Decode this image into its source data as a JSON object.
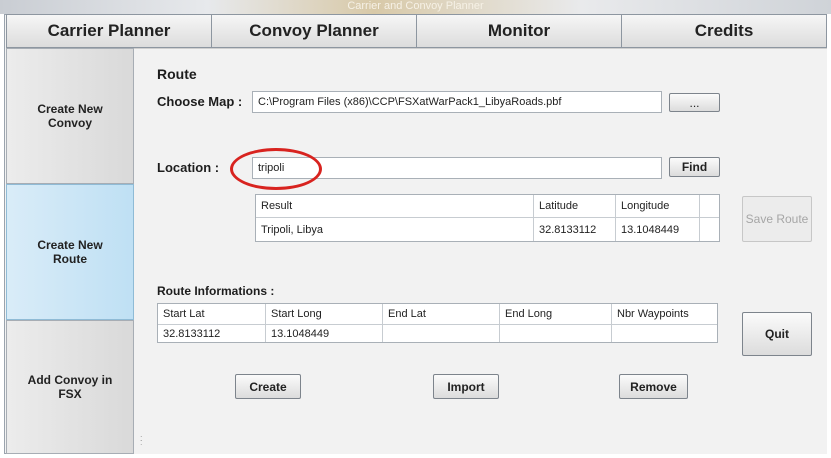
{
  "window": {
    "title": "Carrier and Convoy Planner"
  },
  "tabs": [
    "Carrier Planner",
    "Convoy Planner",
    "Monitor",
    "Credits"
  ],
  "sidebar": {
    "create_convoy": "Create New Convoy",
    "create_route": "Create New Route",
    "add_convoy": "Add Convoy in FSX"
  },
  "route": {
    "section_title": "Route",
    "choose_map_label": "Choose Map :",
    "map_path": "C:\\Program Files (x86)\\CCP\\FSXatWarPack1_LibyaRoads.pbf",
    "browse_label": "...",
    "location_label": "Location :",
    "location_value": "tripoli",
    "find_label": "Find"
  },
  "results": {
    "headers": [
      "Result",
      "Latitude",
      "Longitude"
    ],
    "rows": [
      [
        "Tripoli, Libya",
        "32.8133112",
        "13.1048449"
      ]
    ]
  },
  "route_info": {
    "title": "Route Informations :",
    "headers": [
      "Start Lat",
      "Start Long",
      "End Lat",
      "End Long",
      "Nbr Waypoints"
    ],
    "rows": [
      [
        "32.8133112",
        "13.1048449",
        "",
        "",
        ""
      ]
    ]
  },
  "actions": {
    "save_route": "Save Route",
    "quit": "Quit",
    "create": "Create",
    "import": "Import",
    "remove": "Remove"
  },
  "colors": {
    "highlight_circle": "#d8231f",
    "active_sidebar": "#bfe0f4"
  }
}
